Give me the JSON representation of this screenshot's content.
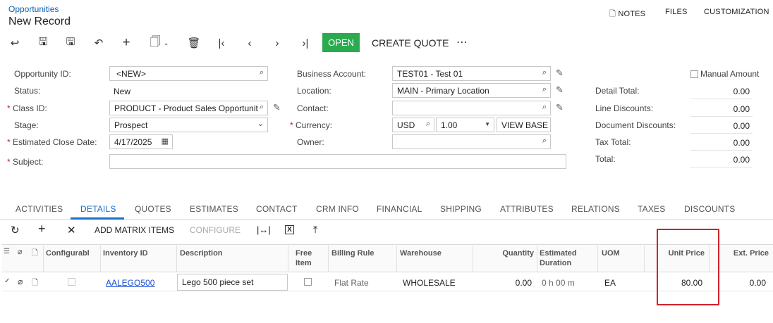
{
  "header": {
    "breadcrumb": "Opportunities",
    "title": "New Record"
  },
  "toplinks": {
    "notes": "NOTES",
    "files": "FILES",
    "customization": "CUSTOMIZATION"
  },
  "toolbar": {
    "open_label": "OPEN",
    "create_quote_label": "CREATE QUOTE",
    "more": "⋯"
  },
  "form": {
    "opportunity_id": {
      "label": "Opportunity ID:",
      "value": "<NEW>"
    },
    "status": {
      "label": "Status:",
      "value": "New"
    },
    "class_id": {
      "label": "Class ID:",
      "value": "PRODUCT - Product Sales Opportunit"
    },
    "stage": {
      "label": "Stage:",
      "value": "Prospect"
    },
    "close_date": {
      "label": "Estimated Close Date:",
      "value": "4/17/2025"
    },
    "subject": {
      "label": "Subject:",
      "value": ""
    },
    "business_account": {
      "label": "Business Account:",
      "value": "TEST01 - Test 01"
    },
    "location": {
      "label": "Location:",
      "value": "MAIN - Primary Location"
    },
    "contact": {
      "label": "Contact:",
      "value": ""
    },
    "currency": {
      "label": "Currency:",
      "code": "USD",
      "rate": "1.00",
      "view_base": "VIEW BASE"
    },
    "owner": {
      "label": "Owner:",
      "value": ""
    }
  },
  "summary": {
    "manual_amount": "Manual Amount",
    "rows": [
      {
        "label": "Detail Total:",
        "value": "0.00"
      },
      {
        "label": "Line Discounts:",
        "value": "0.00"
      },
      {
        "label": "Document Discounts:",
        "value": "0.00"
      },
      {
        "label": "Tax Total:",
        "value": "0.00"
      },
      {
        "label": "Total:",
        "value": "0.00"
      }
    ]
  },
  "tabs": [
    "ACTIVITIES",
    "DETAILS",
    "QUOTES",
    "ESTIMATES",
    "CONTACT",
    "CRM INFO",
    "FINANCIAL",
    "SHIPPING",
    "ATTRIBUTES",
    "RELATIONS",
    "TAXES",
    "DISCOUNTS"
  ],
  "active_tab": "DETAILS",
  "grid_toolbar": {
    "add_matrix": "ADD MATRIX ITEMS",
    "configure": "CONFIGURE"
  },
  "grid": {
    "columns": [
      "Configurabl",
      "Inventory ID",
      "Description",
      "Free Item",
      "Billing Rule",
      "Warehouse",
      "Quantity",
      "Estimated Duration",
      "UOM",
      "Unit Price",
      "Ext. Price"
    ],
    "row": {
      "inventory_id": "AALEGO500",
      "description": "Lego 500 piece set",
      "billing_rule": "Flat Rate",
      "warehouse": "WHOLESALE",
      "quantity": "0.00",
      "duration": "0 h 00 m",
      "uom": "EA",
      "unit_price": "80.00",
      "ext_price": "0.00"
    }
  },
  "colors": {
    "accent": "#1a6fc7",
    "open_button": "#2bab4f",
    "highlight": "#d1232a"
  }
}
